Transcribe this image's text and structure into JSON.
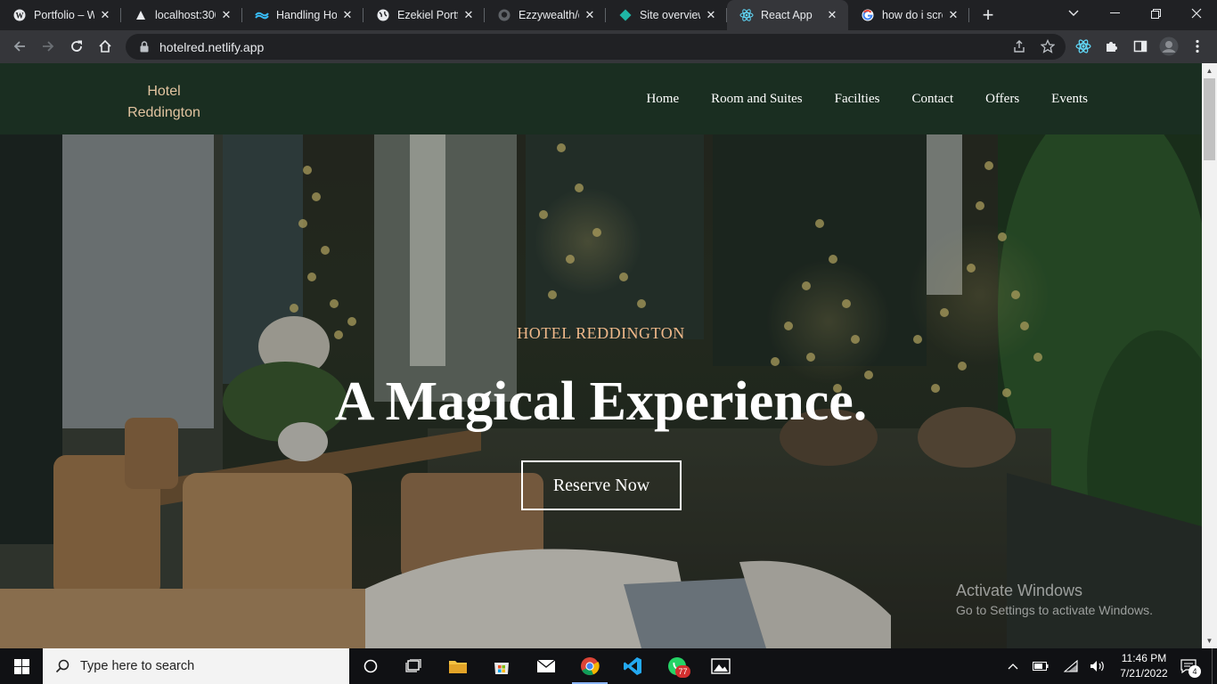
{
  "browser": {
    "tabs": [
      {
        "title": "Portfolio – Wa",
        "icon": "wordpress-icon"
      },
      {
        "title": "localhost:300",
        "icon": "vercel-triangle-icon"
      },
      {
        "title": "Handling How",
        "icon": "tailwind-icon"
      },
      {
        "title": "Ezekiel Portfo",
        "icon": "globe-icon"
      },
      {
        "title": "Ezzywealth/d",
        "icon": "github-icon"
      },
      {
        "title": "Site overview",
        "icon": "netlify-icon"
      },
      {
        "title": "React App",
        "icon": "react-icon"
      },
      {
        "title": "how do i scre",
        "icon": "google-icon"
      }
    ],
    "active_tab": 6,
    "url": "hotelred.netlify.app"
  },
  "site": {
    "brand_line1": "Hotel",
    "brand_line2": "Reddington",
    "nav": [
      "Home",
      "Room and Suites",
      "Facilties",
      "Contact",
      "Offers",
      "Events"
    ],
    "hero": {
      "eyebrow": "HOTEL REDDINGTON",
      "headline": "A Magical Experience.",
      "cta": "Reserve Now"
    }
  },
  "watermark": {
    "line1": "Activate Windows",
    "line2": "Go to Settings to activate Windows."
  },
  "taskbar": {
    "search_placeholder": "Type here to search",
    "whatsapp_badge": "77",
    "time": "11:46 PM",
    "date": "7/21/2022",
    "notification_count": "4"
  },
  "colors": {
    "nav_bg": "#1a2e21",
    "brand": "#e2c4a0",
    "eyebrow": "#f0b98a",
    "chrome_dark": "#202124",
    "chrome_toolbar": "#35363a"
  }
}
